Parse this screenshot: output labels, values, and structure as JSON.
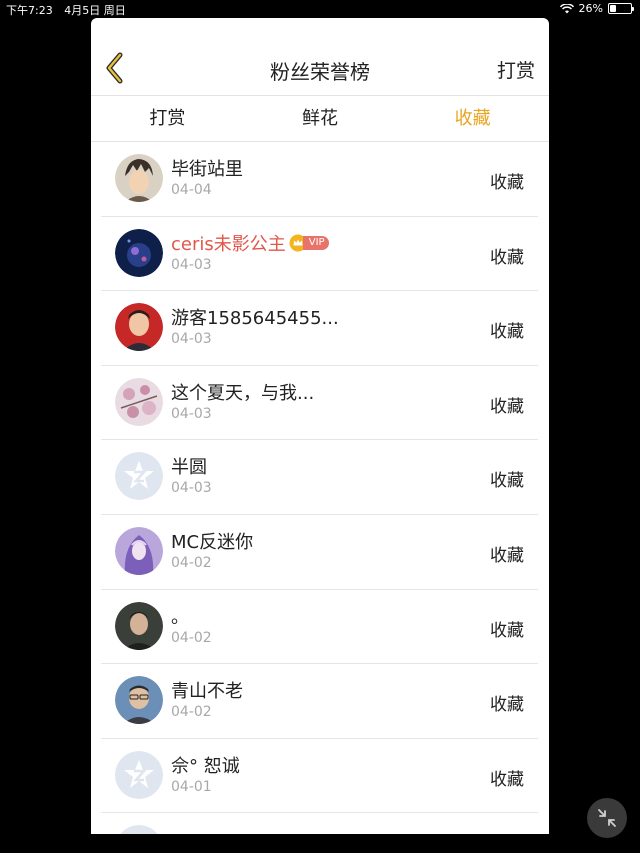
{
  "status_bar": {
    "time": "下午7:23",
    "date": "4月5日 周日",
    "battery": "26%",
    "wifi_icon": "wifi-icon",
    "battery_icon": "battery-icon"
  },
  "header": {
    "back_icon": "chevron-left-icon",
    "title": "粉丝荣誉榜",
    "action": "打赏"
  },
  "tabs": [
    {
      "label": "打赏",
      "active": false
    },
    {
      "label": "鲜花",
      "active": false
    },
    {
      "label": "收藏",
      "active": true
    }
  ],
  "accent_color": "#e8a520",
  "vip_color": "#e0574a",
  "fans": [
    {
      "name": "毕街站里",
      "date": "04-04",
      "action": "收藏",
      "avatar": "anime-boy"
    },
    {
      "name": "ceris未影公主",
      "date": "04-03",
      "action": "收藏",
      "avatar": "dark-orb",
      "vip": "VIP"
    },
    {
      "name": "游客1585645455...",
      "date": "04-03",
      "action": "收藏",
      "avatar": "man-red"
    },
    {
      "name": "这个夏天，与我...",
      "date": "04-03",
      "action": "收藏",
      "avatar": "blossom"
    },
    {
      "name": "半圆",
      "date": "04-03",
      "action": "收藏",
      "avatar": "default"
    },
    {
      "name": "MC反迷你",
      "date": "04-02",
      "action": "收藏",
      "avatar": "purple-girl"
    },
    {
      "name": "。",
      "date": "04-02",
      "action": "收藏",
      "avatar": "man-dark"
    },
    {
      "name": "青山不老",
      "date": "04-02",
      "action": "收藏",
      "avatar": "man-blue"
    },
    {
      "name": "佘° 恕诚",
      "date": "04-01",
      "action": "收藏",
      "avatar": "default"
    }
  ],
  "collapse_icon": "collapse-arrows-icon"
}
